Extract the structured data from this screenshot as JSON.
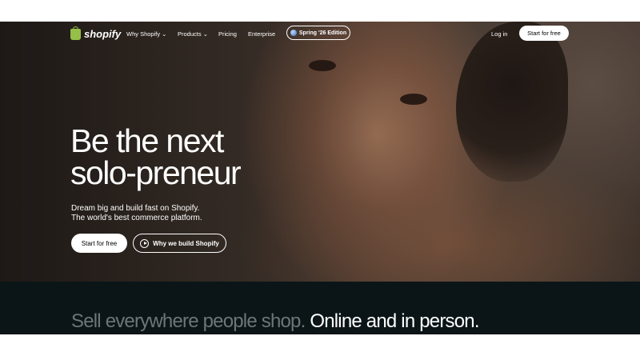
{
  "brand": {
    "name": "shopify",
    "logo_icon": "shopping-bag-icon",
    "accent": "#95bf47"
  },
  "nav": {
    "items": [
      {
        "label": "Why Shopify ⌄"
      },
      {
        "label": "Products ⌄"
      },
      {
        "label": "Pricing"
      },
      {
        "label": "Enterprise"
      }
    ],
    "edition_pill": "Spring '26 Edition",
    "login": "Log in",
    "start": "Start for free"
  },
  "hero": {
    "headline_line1": "Be the next",
    "headline_line2": "solo-preneur",
    "sub_line1": "Dream big and build fast on Shopify.",
    "sub_line2": "The world's best commerce platform.",
    "cta_primary": "Start for free",
    "cta_secondary": "Why we build Shopify"
  },
  "band": {
    "tagline_muted": "Sell everywhere people shop.",
    "tagline_bright": " Online and in person.",
    "background": "#0b1518"
  }
}
